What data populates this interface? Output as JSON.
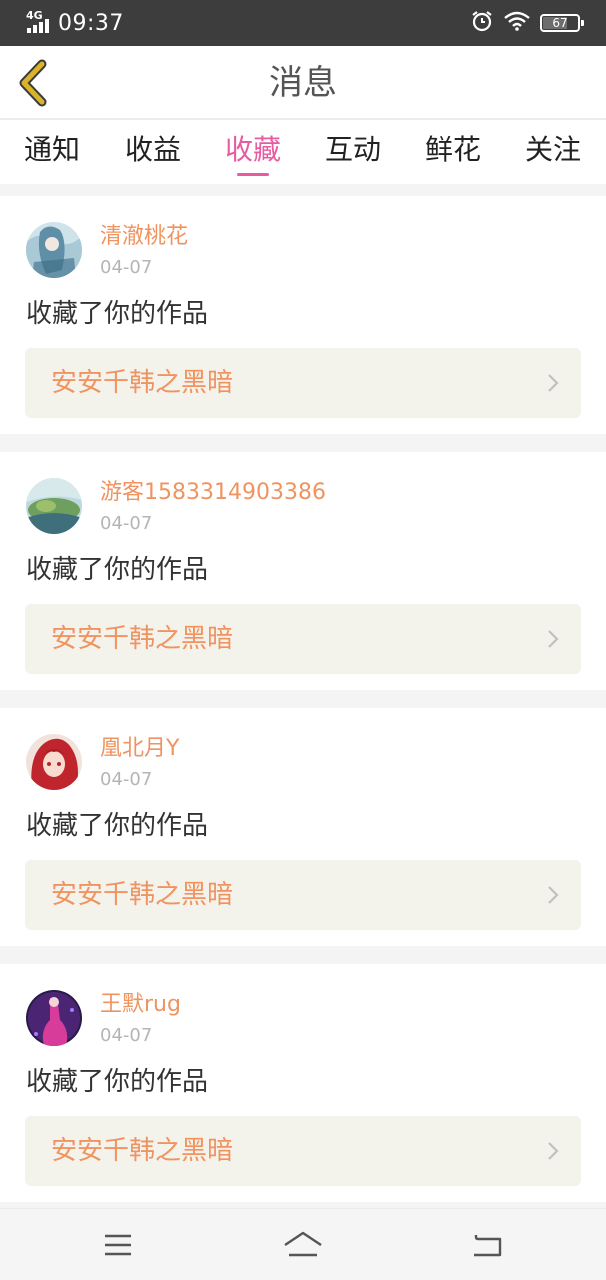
{
  "status_bar": {
    "network_label": "4G",
    "time": "09:37",
    "battery_level": "67",
    "icons": [
      "signal-icon",
      "alarm-icon",
      "wifi-icon",
      "battery-icon"
    ]
  },
  "header": {
    "title": "消息",
    "back_icon": "back-chevron-icon",
    "accent_color": "#d9b42a"
  },
  "tabs": [
    {
      "label": "通知",
      "active": false
    },
    {
      "label": "收益",
      "active": false
    },
    {
      "label": "收藏",
      "active": true
    },
    {
      "label": "互动",
      "active": false
    },
    {
      "label": "鲜花",
      "active": false
    },
    {
      "label": "关注",
      "active": false
    }
  ],
  "colors": {
    "active_tab": "#e75ca0",
    "username": "#ef9461",
    "work_title": "#ef9461",
    "date": "#b5b5b5"
  },
  "messages": [
    {
      "username": "清澈桃花",
      "date": "04-07",
      "action": "收藏了你的作品",
      "work_title": "安安千韩之黑暗"
    },
    {
      "username": "游客1583314903386",
      "date": "04-07",
      "action": "收藏了你的作品",
      "work_title": "安安千韩之黑暗"
    },
    {
      "username": "凰北月Y",
      "date": "04-07",
      "action": "收藏了你的作品",
      "work_title": "安安千韩之黑暗"
    },
    {
      "username": "王默rug",
      "date": "04-07",
      "action": "收藏了你的作品",
      "work_title": "安安千韩之黑暗"
    }
  ],
  "nav_bar": {
    "icons": [
      "menu-icon",
      "home-icon",
      "back-icon"
    ]
  }
}
